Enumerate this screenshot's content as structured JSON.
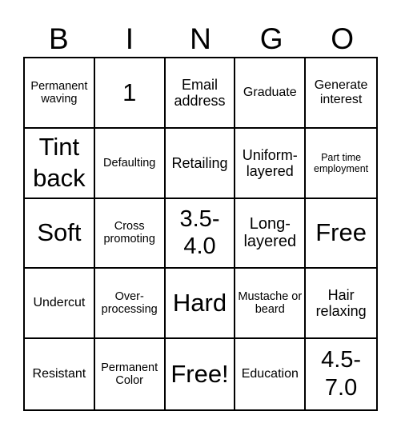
{
  "header": {
    "letters": [
      "B",
      "I",
      "N",
      "G",
      "O"
    ]
  },
  "board": {
    "rows": [
      [
        "Permanent waving",
        "1",
        "Email address",
        "Graduate",
        "Generate interest"
      ],
      [
        "Tint back",
        "Defaulting",
        "Retailing",
        "Uniform-layered",
        "Part time employment"
      ],
      [
        "Soft",
        "Cross promoting",
        "3.5-4.0",
        "Long-layered",
        "Free"
      ],
      [
        "Undercut",
        "Over-processing",
        "Hard",
        "Mustache or beard",
        "Hair relaxing"
      ],
      [
        "Resistant",
        "Permanent Color",
        "Free!",
        "Education",
        "4.5-7.0"
      ]
    ]
  },
  "colors": {
    "text": "#000000",
    "grid_lines": "#000000",
    "background": "#ffffff"
  }
}
